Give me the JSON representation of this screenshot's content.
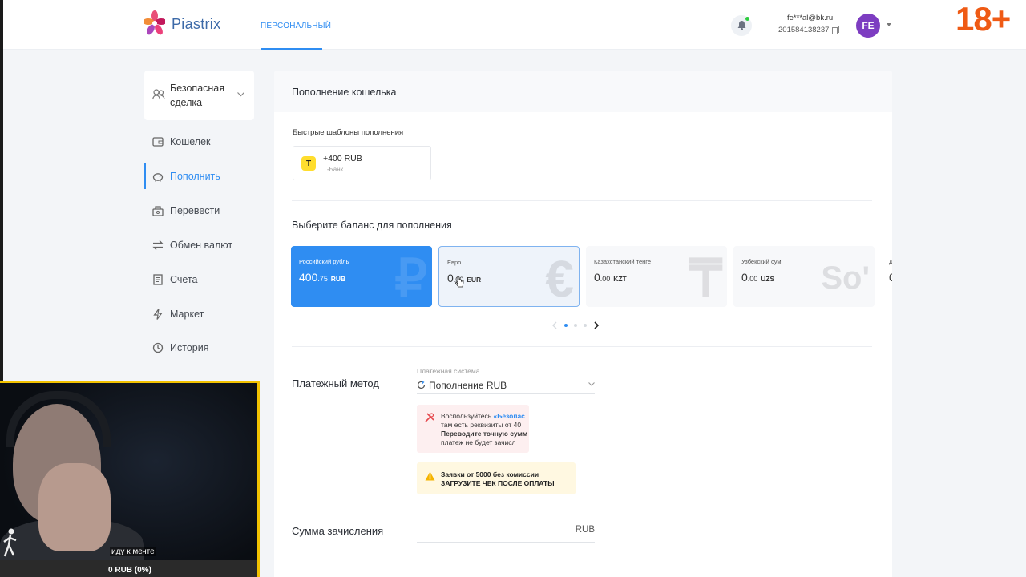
{
  "header": {
    "logo_text": "Piastrix",
    "nav_tab": "ПЕРСОНАЛЬНЫЙ",
    "user_email": "fe***al@bk.ru",
    "user_id": "201584138237",
    "avatar_initials": "FE",
    "age_badge": "18+"
  },
  "sidebar": {
    "deal_label": "Безопасная сделка",
    "items": [
      {
        "label": "Кошелек",
        "icon": "wallet-icon"
      },
      {
        "label": "Пополнить",
        "icon": "piggy-bank-icon",
        "active": true
      },
      {
        "label": "Перевести",
        "icon": "transfer-icon"
      },
      {
        "label": "Обмен валют",
        "icon": "exchange-icon"
      },
      {
        "label": "Счета",
        "icon": "invoice-icon"
      },
      {
        "label": "Маркет",
        "icon": "lightning-icon"
      },
      {
        "label": "История",
        "icon": "history-icon"
      }
    ]
  },
  "main": {
    "title": "Пополнение кошелька",
    "templates_label": "Быстрые шаблоны пополнения",
    "template": {
      "amount": "+400 RUB",
      "bank": "Т-Банк",
      "logo": "Т"
    },
    "balance_label": "Выберите баланс для пополнения",
    "balances": [
      {
        "name": "Российский рубль",
        "int": "400",
        "dec": ".75",
        "code": "RUB",
        "symbol": "₽",
        "selected": true
      },
      {
        "name": "Евро",
        "int": "0",
        "dec": ".00",
        "code": "EUR",
        "symbol": "€",
        "hovered": true
      },
      {
        "name": "Казахстанский тенге",
        "int": "0",
        "dec": ".00",
        "code": "KZT",
        "symbol": "₸"
      },
      {
        "name": "Узбекский сум",
        "int": "0",
        "dec": ".00",
        "code": "UZS",
        "symbol": "So'"
      },
      {
        "name": "Д",
        "int": "0",
        "dec": "",
        "code": "",
        "symbol": ""
      }
    ],
    "payment_method_label": "Платежный метод",
    "payment_system_caption": "Платежная система",
    "payment_system_value": "Пополнение RUB",
    "warning_pink": {
      "line1_prefix": "Воспользуйтесь ",
      "line1_link": "«Безопас",
      "line2": "там есть реквизиты от 40",
      "line3": "Переводите точную сумм",
      "line4": "платеж не будет зачисл"
    },
    "warning_yellow": {
      "line1": "Заявки от 5000 без комиссии",
      "line2": "ЗАГРУЗИТЕ ЧЕК ПОСЛЕ ОПЛАТЫ"
    },
    "amount_label": "Сумма зачисления",
    "amount_currency": "RUB"
  },
  "webcam": {
    "caption": "иду к мечте",
    "progress_text": "0 RUB (0%)"
  },
  "colors": {
    "accent": "#2f8df2",
    "age_badge": "#ef5a14",
    "avatar": "#7d3dc1",
    "webcam_border": "#f2c200"
  }
}
